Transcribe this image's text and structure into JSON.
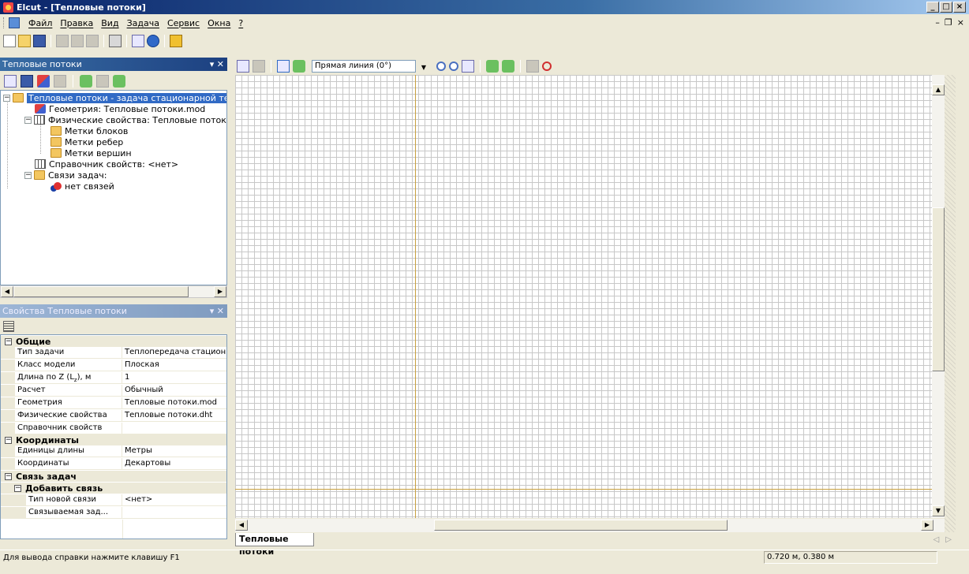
{
  "window": {
    "title": "Elcut - [Тепловые потоки]"
  },
  "menu": [
    {
      "label": "Файл"
    },
    {
      "label": "Правка"
    },
    {
      "label": "Вид"
    },
    {
      "label": "Задача"
    },
    {
      "label": "Сервис"
    },
    {
      "label": "Окна"
    },
    {
      "label": "?"
    }
  ],
  "tree_panel": {
    "title": "Тепловые потоки",
    "items": [
      {
        "label": "Тепловые потоки - задача стационарной теплоп"
      },
      {
        "label": "Геометрия: Тепловые потоки.mod"
      },
      {
        "label": "Физические свойства: Тепловые потоки.dht"
      },
      {
        "label": "Метки блоков"
      },
      {
        "label": "Метки ребер"
      },
      {
        "label": "Метки вершин"
      },
      {
        "label": "Справочник свойств: <нет>"
      },
      {
        "label": "Связи задач:"
      },
      {
        "label": "нет связей"
      }
    ]
  },
  "props_panel": {
    "title": "Свойства Тепловые потоки",
    "sections": {
      "general": "Общие",
      "coords": "Координаты",
      "links": "Связь задач",
      "add_link": "Добавить связь"
    },
    "rows": {
      "task_type": {
        "key": "Тип задачи",
        "value": "Теплопередача стацион..."
      },
      "model_class": {
        "key": "Класс модели",
        "value": "Плоская"
      },
      "length_z": {
        "key": "Длина по Z (L",
        "sub": "z",
        "tail": "), м",
        "value": "1"
      },
      "calc": {
        "key": "Расчет",
        "value": "Обычный"
      },
      "geometry": {
        "key": "Геометрия",
        "value": "Тепловые потоки.mod"
      },
      "physical": {
        "key": "Физические свойства",
        "value": "Тепловые потоки.dht"
      },
      "reference": {
        "key": "Справочник свойств",
        "value": ""
      },
      "units": {
        "key": "Единицы длины",
        "value": "Метры"
      },
      "coordinates": {
        "key": "Координаты",
        "value": "Декартовы"
      },
      "new_link": {
        "key": "Тип новой связи",
        "value": "<нет>"
      },
      "linked_task": {
        "key": "Связываемая зад...",
        "value": ""
      }
    }
  },
  "doc_toolbar": {
    "line_mode": "Прямая линия (0°)"
  },
  "doc_tab": "Тепловые потоки",
  "status": {
    "help": "Для вывода справки нажмите клавишу F1",
    "coords": "0.720 м, 0.380 м"
  },
  "colors": {
    "title_bar": "#0a246a",
    "selection": "#316ac5",
    "axis": "#c8a040",
    "grid": "#c8c8c8"
  },
  "icons": [
    "app-icon",
    "new-icon",
    "open-icon",
    "save-icon",
    "cut-icon",
    "copy-icon",
    "paste-icon",
    "print-icon",
    "context-help-icon",
    "about-icon",
    "zoom-in-icon",
    "zoom-out-icon",
    "zoom-fit-icon"
  ]
}
